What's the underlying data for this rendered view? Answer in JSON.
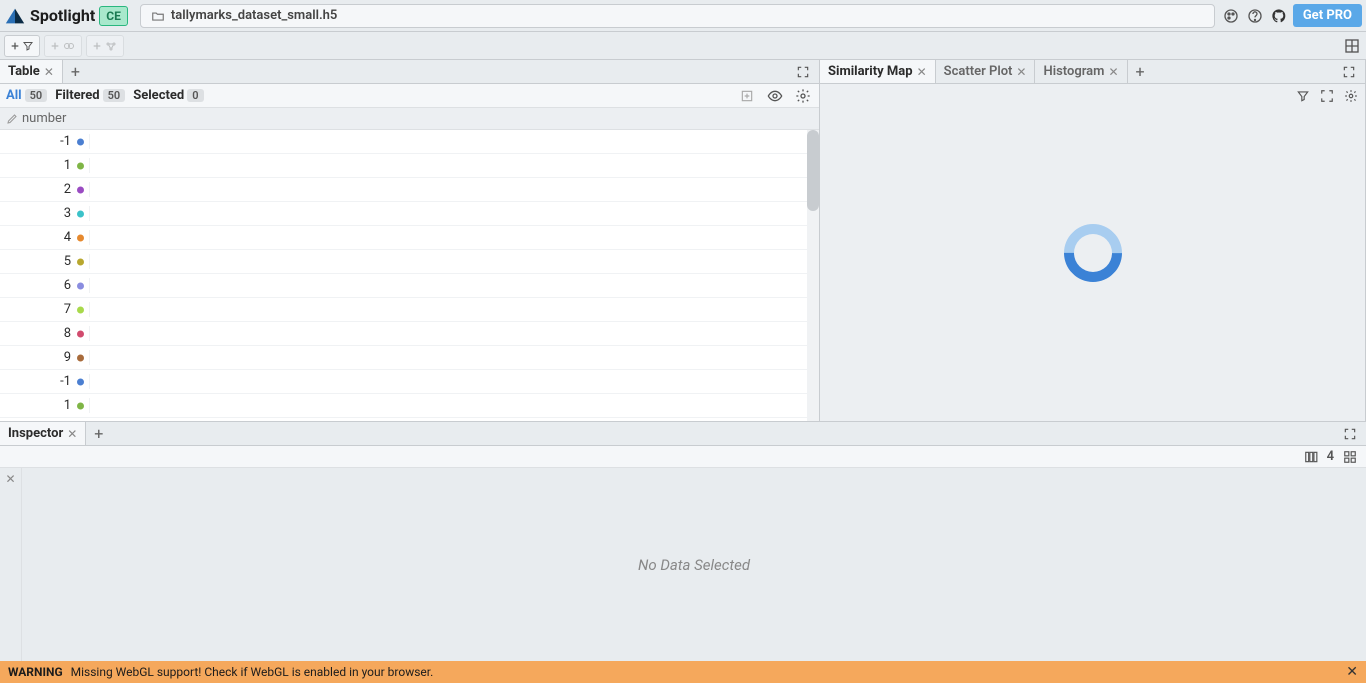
{
  "header": {
    "app_name": "Spotlight",
    "edition_badge": "CE",
    "filename": "tallymarks_dataset_small.h5",
    "get_pro_label": "Get PRO"
  },
  "panel_left": {
    "tabs": [
      {
        "label": "Table"
      }
    ],
    "filters": {
      "all_label": "All",
      "all_count": "50",
      "filtered_label": "Filtered",
      "filtered_count": "50",
      "selected_label": "Selected",
      "selected_count": "0"
    },
    "column_header": "number",
    "rows": [
      {
        "value": "-1",
        "color": "#4b7fd1"
      },
      {
        "value": "1",
        "color": "#7fb546"
      },
      {
        "value": "2",
        "color": "#9a4bc2"
      },
      {
        "value": "3",
        "color": "#3bc2c9"
      },
      {
        "value": "4",
        "color": "#e6892e"
      },
      {
        "value": "5",
        "color": "#b8a72e"
      },
      {
        "value": "6",
        "color": "#8a8de0"
      },
      {
        "value": "7",
        "color": "#a8d94b"
      },
      {
        "value": "8",
        "color": "#d14b6e"
      },
      {
        "value": "9",
        "color": "#a86b3b"
      },
      {
        "value": "-1",
        "color": "#4b7fd1"
      },
      {
        "value": "1",
        "color": "#7fb546"
      }
    ]
  },
  "panel_right": {
    "tabs": [
      {
        "label": "Similarity Map",
        "active": true
      },
      {
        "label": "Scatter Plot",
        "active": false
      },
      {
        "label": "Histogram",
        "active": false
      }
    ]
  },
  "inspector": {
    "tab_label": "Inspector",
    "grid_count": "4",
    "empty_text": "No Data Selected"
  },
  "warning": {
    "label": "WARNING",
    "message": "Missing WebGL support! Check if WebGL is enabled in your browser."
  }
}
